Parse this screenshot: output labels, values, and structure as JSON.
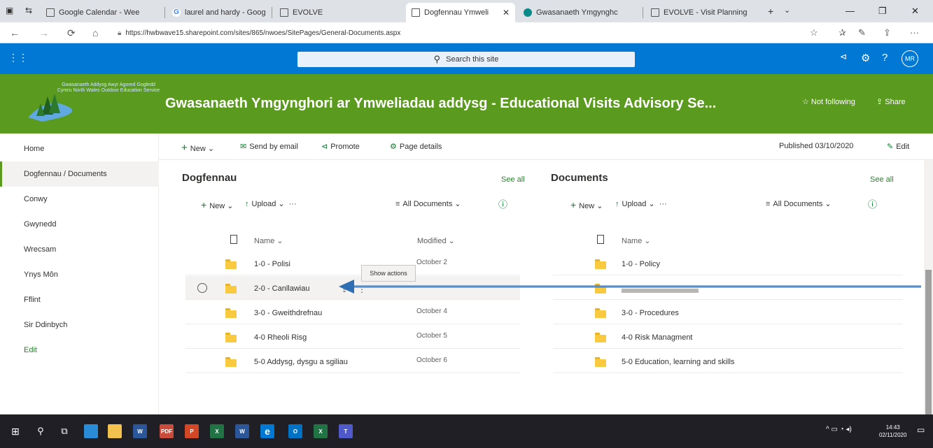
{
  "browser": {
    "tabs": [
      {
        "label": "Google Calendar - Wee",
        "icon": "page-icon"
      },
      {
        "label": "laurel and hardy - Goog",
        "icon": "google-icon"
      },
      {
        "label": "EVOLVE",
        "icon": "page-icon"
      },
      {
        "label": "Dogfennau Ymweli",
        "icon": "page-icon",
        "active": true
      },
      {
        "label": "Gwasanaeth Ymgynghc",
        "icon": "sharepoint-icon"
      },
      {
        "label": "EVOLVE - Visit Planning",
        "icon": "page-icon"
      }
    ],
    "url": "https://hwbwave15.sharepoint.com/sites/865/nwoes/SitePages/General-Documents.aspx"
  },
  "suite": {
    "search_placeholder": "Search this site",
    "avatar_initials": "MR"
  },
  "header": {
    "logo_text": "Gwasanaeth Addysg Awyr Agored Gogledd Cymru North Wales Outdoor Education Service",
    "site_title": "Gwasanaeth Ymgynghori ar Ymweliadau addysg - Educational Visits Advisory Se...",
    "follow_label": "Not following",
    "share_label": "Share",
    "brand_color": "#5a9a1e"
  },
  "leftnav": {
    "items": [
      "Home",
      "Dogfennau / Documents",
      "Conwy",
      "Gwynedd",
      "Wrecsam",
      "Ynys Môn",
      "Fflint",
      "Sir Ddinbych"
    ],
    "edit_label": "Edit"
  },
  "commandbar": {
    "new_label": "New",
    "email_label": "Send by email",
    "promote_label": "Promote",
    "details_label": "Page details",
    "published": "Published 03/10/2020",
    "edit_label": "Edit"
  },
  "left_lib": {
    "title": "Dogfennau",
    "see_all": "See all",
    "new_label": "New",
    "upload_label": "Upload",
    "view_label": "All Documents",
    "col_name": "Name",
    "col_modified": "Modified",
    "rows": [
      {
        "name": "1-0 - Polisi",
        "modified": "October 2"
      },
      {
        "name": "2-0 - Canllawiau",
        "modified": ""
      },
      {
        "name": "3-0 - Gweithdrefnau",
        "modified": "October 4"
      },
      {
        "name": "4-0 Rheoli Risg",
        "modified": "October 5"
      },
      {
        "name": "5-0 Addysg, dysgu a sgiliau",
        "modified": "October 6"
      }
    ],
    "tooltip": "Show actions"
  },
  "right_lib": {
    "title": "Documents",
    "see_all": "See all",
    "new_label": "New",
    "upload_label": "Upload",
    "view_label": "All Documents",
    "col_name": "Name",
    "rows": [
      {
        "name": "1-0 - Policy"
      },
      {
        "name": ""
      },
      {
        "name": "3-0 - Procedures"
      },
      {
        "name": "4-0 Risk Managment"
      },
      {
        "name": "5-0 Education, learning and skills"
      }
    ]
  },
  "taskbar": {
    "time": "14:43",
    "date": "02/11/2020"
  }
}
